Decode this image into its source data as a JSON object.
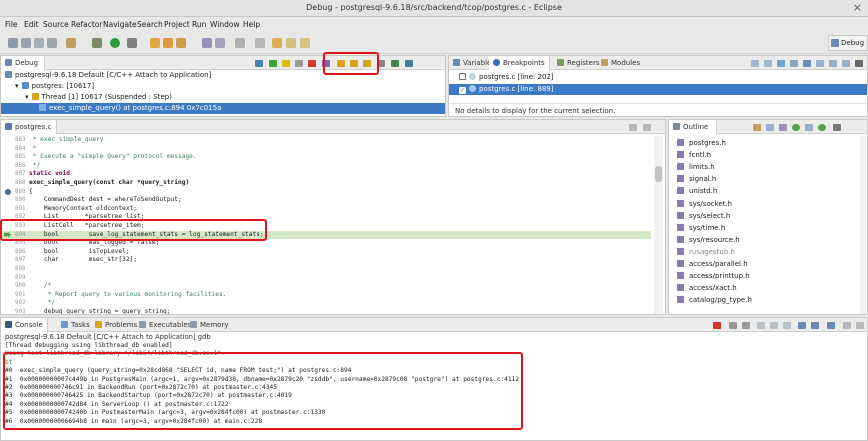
{
  "window": {
    "title": "Debug - postgresql-9.6.18/src/backend/tcop/postgres.c - Eclipse",
    "close_glyph": "×"
  },
  "menu": [
    "File",
    "Edit",
    "Source",
    "Refactor",
    "Navigate",
    "Search",
    "Project",
    "Run",
    "Window",
    "Help"
  ],
  "perspective": {
    "label": "Debug"
  },
  "debug_view": {
    "tab_label": "Debug",
    "rows": [
      "postgresql-9.6.18 Default [C/C++ Attach to Application]",
      "postgres: [10617]",
      "Thread [1] 10617 (Suspended : Step)",
      "exec_simple_query() at postgres.c:894 0x7c015a"
    ]
  },
  "breakpoints_view": {
    "tabs": [
      "Variables",
      "Breakpoints",
      "Registers",
      "Modules"
    ],
    "items": [
      {
        "label": "postgres.c [line: 202]",
        "checked": false
      },
      {
        "label": "postgres.c [line: 889]",
        "checked": true
      }
    ],
    "detail": "No details to display for the current selection."
  },
  "editor": {
    "tab_label": "postgres.c",
    "lines": [
      {
        "n": "883",
        "t": " * exec_simple_query",
        "c": "cmt"
      },
      {
        "n": "884",
        "t": " *",
        "c": "cmt"
      },
      {
        "n": "885",
        "t": " * Execute a \"simple Query\" protocol message.",
        "c": "cmt"
      },
      {
        "n": "886",
        "t": " */",
        "c": "cmt"
      },
      {
        "n": "887",
        "t": "static void",
        "c": "kw"
      },
      {
        "n": "888",
        "t": "exec_simple_query(const char *query_string)",
        "c": "bold"
      },
      {
        "n": "889",
        "t": "{",
        "c": ""
      },
      {
        "n": "890",
        "t": "    CommandDest dest = whereToSendOutput;",
        "c": ""
      },
      {
        "n": "891",
        "t": "    MemoryContext oldcontext;",
        "c": ""
      },
      {
        "n": "892",
        "t": "    List       *parsetree_list;",
        "c": ""
      },
      {
        "n": "893",
        "t": "    ListCell   *parsetree_item;",
        "c": ""
      },
      {
        "n": "894",
        "t": "    bool        save_log_statement_stats = log_statement_stats;",
        "c": "hl"
      },
      {
        "n": "895",
        "t": "    bool        was_logged = false;",
        "c": ""
      },
      {
        "n": "896",
        "t": "    bool        isTopLevel;",
        "c": ""
      },
      {
        "n": "897",
        "t": "    char        msec_str[32];",
        "c": ""
      },
      {
        "n": "898",
        "t": "",
        "c": ""
      },
      {
        "n": "899",
        "t": "",
        "c": ""
      },
      {
        "n": "900",
        "t": "    /*",
        "c": "cmt"
      },
      {
        "n": "901",
        "t": "     * Report query to various monitoring facilities.",
        "c": "cmt"
      },
      {
        "n": "902",
        "t": "     */",
        "c": "cmt"
      },
      {
        "n": "903",
        "t": "    debug_query_string = query_string;",
        "c": ""
      }
    ]
  },
  "outline": {
    "tab_label": "Outline",
    "items": [
      "postgres.h",
      "fcntl.h",
      "limits.h",
      "signal.h",
      "unistd.h",
      "sys/socket.h",
      "sys/select.h",
      "sys/time.h",
      "sys/resource.h",
      "rusagestub.h",
      "access/parallel.h",
      "access/printtup.h",
      "access/xact.h",
      "catalog/pg_type.h"
    ]
  },
  "console": {
    "tabs": [
      "Console",
      "Tasks",
      "Problems",
      "Executables",
      "Memory"
    ],
    "header": "postgresql-9.6.18 Default [C/C++ Attach to Application] gdb",
    "lines": [
      "[Thread debugging using libthread_db enabled]",
      "Using host libthread_db library \"/lib64/libthread_db.so.1\".",
      "bt",
      "#0  exec_simple_query (query_string=0x28cd868 \"SELECT id, name FROM test;\") at postgres.c:894",
      "#1  0x00000000007c449b in PostgresMain (argc=1, argv=0x2879d38, dbname=0x2879c20 \"zsddb\", username=0x2879c08 \"postgre\") at postgres.c:4112",
      "#2  0x000000000746c91 in BackendRun (port=0x2872c70) at postmaster.c:4345",
      "#3  0x000000000746425 in BackendStartup (port=0x2872c70) at postmaster.c:4019",
      "#4  0x0000000000742d84 in ServerLoop () at postmaster.c:1722",
      "#5  0x000000000074240b in PostmasterMain (argc=3, argv=0x284fc00) at postmaster.c:1330",
      "#6  0x00000000006694b8 in main (argc=3, argv=0x284fc00) at main.c:228"
    ]
  }
}
